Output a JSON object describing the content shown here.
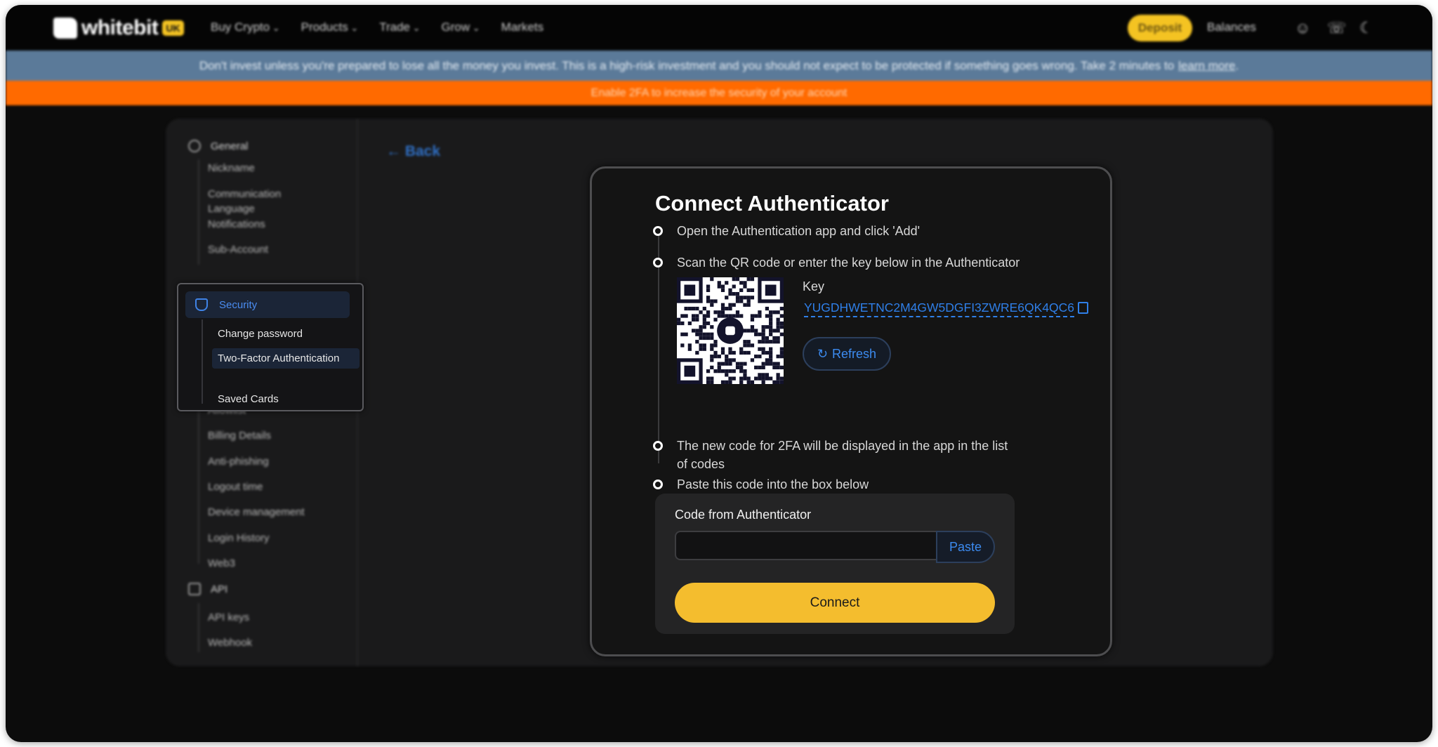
{
  "header": {
    "logo_text": "whitebit",
    "logo_badge": "UK",
    "nav": [
      "Buy Crypto",
      "Products",
      "Trade",
      "Grow",
      "Markets"
    ],
    "deposit_label": "Deposit",
    "balances_label": "Balances"
  },
  "notice": {
    "text": "Don't invest unless you're prepared to lose all the money you invest. This is a high-risk investment and you should not expect to be protected if something goes wrong. Take 2 minutes to",
    "link": "learn more",
    "end": "."
  },
  "alert": {
    "text": "Enable 2FA to increase the security of your account"
  },
  "back_label": "← Back",
  "sidebar": {
    "general_label": "General",
    "general_items": [
      "Nickname",
      "Communication Language",
      "Notifications",
      "Sub-Account"
    ],
    "security_label": "Security",
    "security_items": [
      "Change password",
      "Two-Factor Authentication",
      "Saved Cards"
    ],
    "more_items": [
      "Allowlist",
      "Billing Details",
      "Anti-phishing",
      "Logout time",
      "Device management",
      "Login History",
      "Web3"
    ],
    "api_label": "API",
    "api_items": [
      "API keys",
      "Webhook"
    ]
  },
  "dialog": {
    "title": "Connect Authenticator",
    "step1": "Open the Authentication app and click 'Add'",
    "step2": "Scan the QR code or enter the key below in the Authenticator",
    "key_label": "Key",
    "key_value": "YUGDHWETNC2M4GW5DGFI3ZWRE6QK4QC6",
    "refresh_label": "Refresh",
    "step3_line1": "The new code for 2FA will be displayed in the app in the list",
    "step3_line2": "of codes",
    "step4": "Paste this code into the box below",
    "code_label": "Code from Authenticator",
    "code_value": "",
    "paste_label": "Paste",
    "connect_label": "Connect"
  }
}
